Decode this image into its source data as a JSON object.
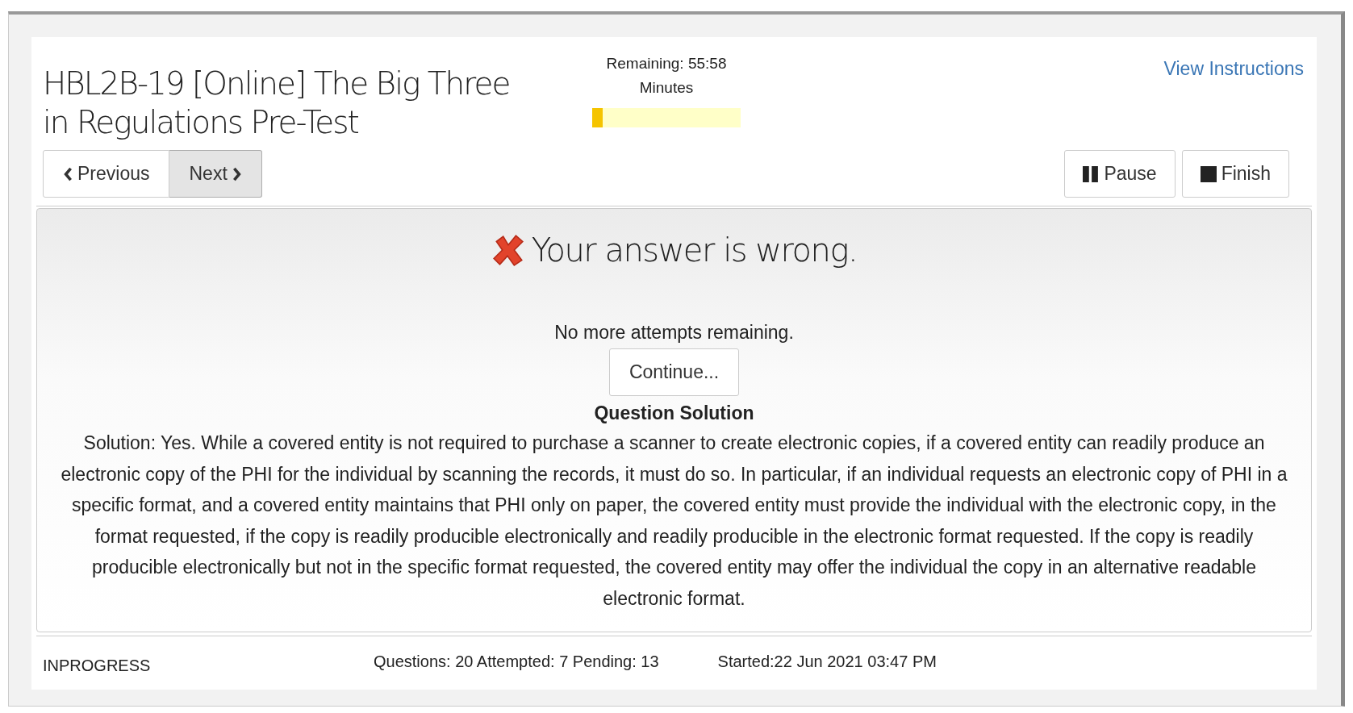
{
  "title": "HBL2B-19 [Online] The Big Three in Regulations Pre-Test",
  "timer": {
    "remaining": "Remaining: 55:58",
    "unit": "Minutes",
    "level": 0.07
  },
  "instructions_link": "View Instructions",
  "nav_buttons": [
    {
      "label": "Previous",
      "kind": "prev",
      "selected": false
    },
    {
      "label": "Next",
      "kind": "next",
      "selected": true
    }
  ],
  "actions": [
    {
      "label": "Pause",
      "kind": "pause"
    },
    {
      "label": "Finish",
      "kind": "finish"
    }
  ],
  "result": {
    "heading": "Your answer is wrong.",
    "correct": false,
    "attempts": "No more attempts remaining.",
    "continue_button": "Continue...",
    "solution_heading": "Question Solution",
    "solution": "Solution: Yes. While a covered entity is not required to purchase a scanner to create electronic copies, if a covered entity can readily produce an electronic copy of the PHI for the individual by scanning the records, it must do so. In particular, if an individual requests an electronic copy of PHI in a specific format, and a covered entity maintains that PHI only on paper, the covered entity must provide the individual with the electronic copy, in the format requested, if the copy is readily producible electronically and readily producible in the electronic format requested. If the copy is readily producible electronically but not in the specific format requested, the covered entity may offer the individual the copy in an alternative readable electronic format."
  },
  "status_bar": {
    "status": "INPROGRESS",
    "counts": "Questions: 20 Attempted: 7 Pending: 13",
    "started": "Started:22 Jun 2021 03:47 PM"
  }
}
